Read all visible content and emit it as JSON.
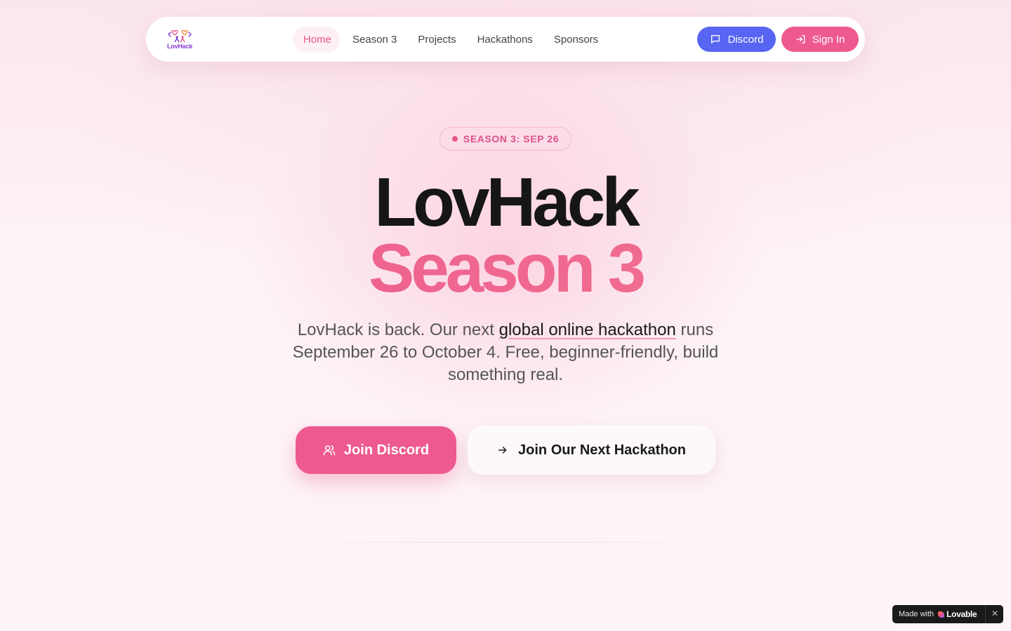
{
  "nav": {
    "logo_text": "LovHack",
    "links": [
      {
        "label": "Home",
        "active": true
      },
      {
        "label": "Season 3",
        "active": false
      },
      {
        "label": "Projects",
        "active": false
      },
      {
        "label": "Hackathons",
        "active": false
      },
      {
        "label": "Sponsors",
        "active": false
      }
    ],
    "discord_label": "Discord",
    "signin_label": "Sign In"
  },
  "hero": {
    "badge": "SEASON 3: SEP 26",
    "title_line1": "LovHack",
    "title_line2": "Season 3",
    "subtitle_pre": "LovHack is back. Our next ",
    "subtitle_link": "global online hackathon",
    "subtitle_post": " runs September 26 to October 4. Free, beginner-friendly, build something real.",
    "cta_primary": "Join Discord",
    "cta_secondary": "Join Our Next Hackathon"
  },
  "footer_badge": {
    "made_with": "Made with",
    "brand": "Lovable",
    "close": "✕"
  },
  "colors": {
    "accent_pink": "#ee5a8f",
    "discord_blue": "#5865f2",
    "badge_bg": "#fbdce7"
  },
  "icons": {
    "discord_button": "message-square-icon",
    "signin_button": "log-in-icon",
    "join_discord": "users-icon",
    "join_hackathon": "arrow-right-icon"
  }
}
